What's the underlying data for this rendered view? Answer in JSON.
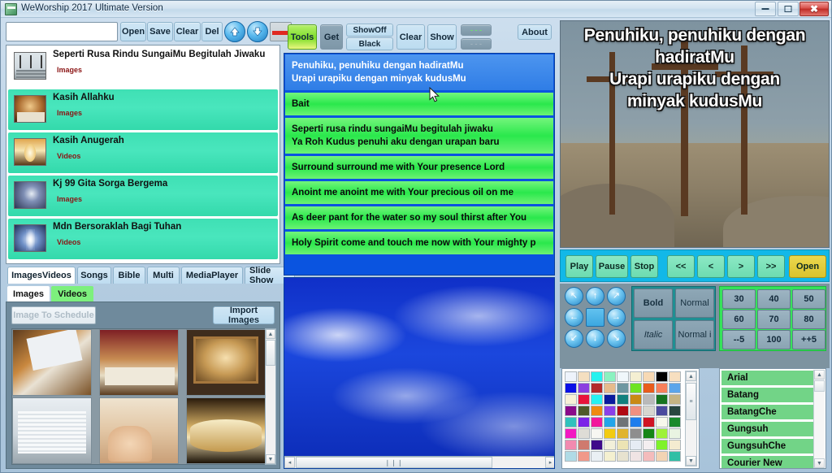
{
  "window": {
    "title": "WeWorship 2017 Ultimate Version",
    "icon": "app-icon",
    "minimize": "–",
    "maximize": "□",
    "close": "✖"
  },
  "left": {
    "search": {
      "value": "",
      "placeholder": ""
    },
    "toolbar": {
      "open": "Open",
      "save": "Save",
      "clear": "Clear",
      "del": "Del",
      "move_up_icon": "arrow-up-icon",
      "move_down_icon": "arrow-down-icon",
      "red_bar_button": "red-bar-button"
    },
    "songs": [
      {
        "title": "Seperti Rusa Rindu SungaiMu Begitulah Jiwaku",
        "type": "Images",
        "thumb": "cross-hill",
        "selected": true
      },
      {
        "title": "Kasih Allahku",
        "type": "Images",
        "thumb": "last-supper"
      },
      {
        "title": "Kasih Anugerah",
        "type": "Videos",
        "thumb": "candle-light"
      },
      {
        "title": "Kj 99 Gita Sorga Bergema",
        "type": "Images",
        "thumb": "blue-swirl"
      },
      {
        "title": "Mdn Bersoraklah Bagi Tuhan",
        "type": "Videos",
        "thumb": "angel-light"
      }
    ],
    "tabs": [
      {
        "label": "ImagesVideos",
        "active": true
      },
      {
        "label": "Songs",
        "active": false
      },
      {
        "label": "Bible",
        "active": false
      },
      {
        "label": "Multi",
        "active": false
      },
      {
        "label": "MediaPlayer",
        "active": false
      },
      {
        "label": "Slide Show",
        "active": false
      }
    ],
    "subtabs": [
      {
        "label": "Images",
        "active": true
      },
      {
        "label": "Videos",
        "active": false
      }
    ],
    "image_to_schedule": "Image To Schedule",
    "import_images": "Import Images",
    "thumbnails": [
      {
        "name": "hands-holding-page",
        "art": "tc-hands"
      },
      {
        "name": "last-supper-painting",
        "art": "tc-lastsupper"
      },
      {
        "name": "framed-last-supper",
        "art": "tc-frame"
      },
      {
        "name": "open-bible-grey",
        "art": "tc-bible"
      },
      {
        "name": "hand-on-book",
        "art": "tc-hand2"
      },
      {
        "name": "open-bible-gold",
        "art": "tc-openbible"
      }
    ]
  },
  "center": {
    "toolbar": {
      "tools": "Tools",
      "get": "Get",
      "showoff": "ShowOff",
      "black": "Black",
      "clear": "Clear",
      "show": "Show",
      "dash_top": "- - -",
      "dash_bottom": "- - -",
      "about": "About"
    },
    "lyrics": [
      {
        "lines": [
          "Penuhiku, penuhiku dengan hadiratMu",
          "Urapi urapiku dengan minyak kudusMu"
        ],
        "selected": true
      },
      {
        "lines": [
          "Bait"
        ],
        "selected": false
      },
      {
        "lines": [
          "Seperti rusa rindu sungaiMu begitulah jiwaku",
          "Ya Roh Kudus penuhi aku dengan urapan baru"
        ],
        "selected": false
      },
      {
        "lines": [
          "Surround surround me with Your presence Lord"
        ],
        "selected": false
      },
      {
        "lines": [
          "Anoint me anoint me with Your precious oil on me"
        ],
        "selected": false
      },
      {
        "lines": [
          "As deer pant for the water so my soul thirst after You"
        ],
        "selected": false
      },
      {
        "lines": [
          "Holy Spirit come and touch me now with Your mighty p"
        ],
        "selected": false
      }
    ],
    "preview_background": "blue-sky-clouds",
    "hscroll": {
      "left_icon": "◂",
      "right_icon": "▸",
      "grip": "❘❘❘"
    }
  },
  "right": {
    "preview_text": [
      "Penuhiku, penuhiku dengan",
      "hadiratMu",
      "Urapi urapiku dengan",
      "minyak kudusMu"
    ],
    "preview_background": "three-crosses-on-hill",
    "player": {
      "play": "Play",
      "pause": "Pause",
      "stop": "Stop",
      "rewind": "<<",
      "prev": "<",
      "next": ">",
      "forward": ">>",
      "open": "Open"
    },
    "arrows": [
      {
        "name": "arrow-up-left-icon",
        "glyph": "↖"
      },
      {
        "name": "arrow-up-icon",
        "glyph": "↑"
      },
      {
        "name": "arrow-up-right-icon",
        "glyph": "↗"
      },
      {
        "name": "arrow-left-icon",
        "glyph": "←"
      },
      {
        "name": "center-block-icon",
        "glyph": ""
      },
      {
        "name": "arrow-right-icon",
        "glyph": "→"
      },
      {
        "name": "arrow-down-left-icon",
        "glyph": "↙"
      },
      {
        "name": "arrow-down-icon",
        "glyph": "↓"
      },
      {
        "name": "arrow-down-right-icon",
        "glyph": "↘"
      }
    ],
    "format": {
      "bold": "Bold",
      "normal": "Normal",
      "italic": "Italic",
      "normal_italic": "Normal i"
    },
    "sizes": [
      "30",
      "40",
      "50",
      "60",
      "70",
      "80",
      "--5",
      "100",
      "++5"
    ],
    "colors": [
      [
        "#eef3fb",
        "#f4dfc0",
        "#26f2ef",
        "#8bf2c0",
        "#f0f7fb",
        "#f4efd2",
        "#f7d9b4",
        "#000000",
        "#f7dfc0"
      ],
      [
        "#0a10e6",
        "#8b3fe0",
        "#b42a2a",
        "#e6bb8c",
        "#6e97a1",
        "#6ee323",
        "#e85c1c",
        "#f87f5a",
        "#5ba5ea"
      ],
      [
        "#f7f0d6",
        "#e8143c",
        "#25f2f2",
        "#0a1a9e",
        "#12807e",
        "#c98a15",
        "#b9b9b9",
        "#16731f",
        "#c5b483"
      ],
      [
        "#8a0a8a",
        "#4e5a2a",
        "#ef8a10",
        "#8b3fe8",
        "#b00a14",
        "#f09080",
        "#d6d6cf",
        "#4a4a9e",
        "#29463f"
      ],
      [
        "#2fc2bd",
        "#7b22e8",
        "#f2189c",
        "#22a5ea",
        "#6f7477",
        "#1d7ded",
        "#d01424",
        "#f7f8ec",
        "#1a8a2c"
      ],
      [
        "#f218c2",
        "#dedcd6",
        "#f7f7f2",
        "#f2cb12",
        "#e0b42e",
        "#8e8e8e",
        "#168616",
        "#9ef23a",
        "#e9f4e2"
      ],
      [
        "#f28ab0",
        "#cf7a6e",
        "#3f0a8a",
        "#f2f0da",
        "#ece4b4",
        "#e6ecf4",
        "#f4eef0",
        "#7ff22a",
        "#f4ecd0"
      ],
      [
        "#b0dbe6",
        "#f0998a",
        "#eaf0f4",
        "#f4f0d0",
        "#e7e2cf",
        "#f0e4e4",
        "#f4bcbc",
        "#f2d4b4",
        "#2fbfa5"
      ]
    ],
    "fonts": [
      "Arial",
      "Batang",
      "BatangChe",
      "Gungsuh",
      "GungsuhChe",
      "Courier New"
    ],
    "scroll_icons": {
      "up": "▲",
      "down": "▼",
      "grip": "≡"
    }
  }
}
